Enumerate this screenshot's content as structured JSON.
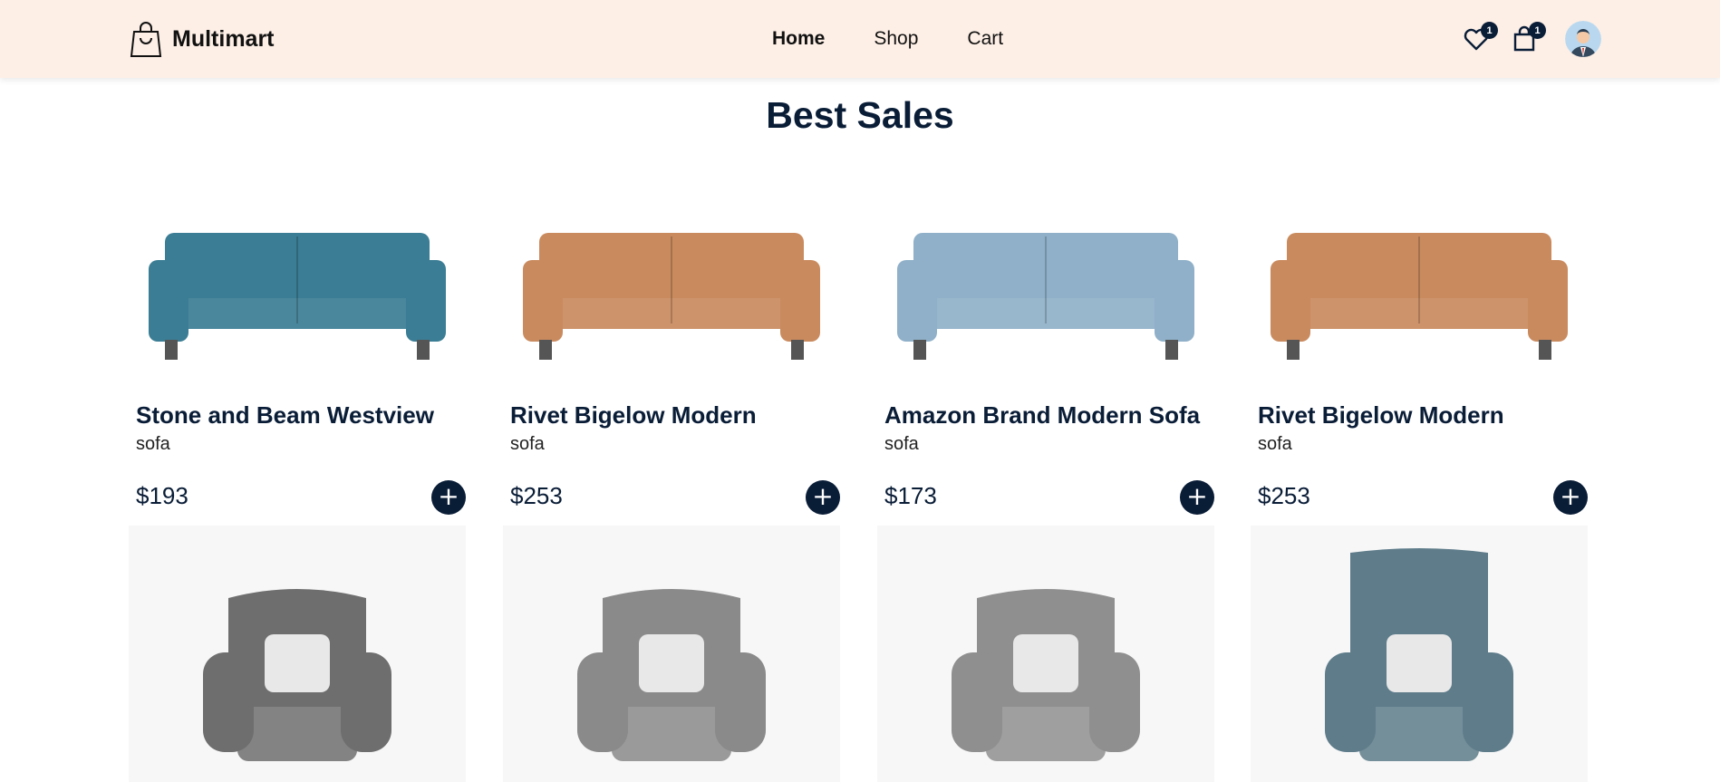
{
  "navbar": {
    "brand": "Multimart",
    "links": [
      {
        "label": "Home",
        "active": true
      },
      {
        "label": "Shop",
        "active": false
      },
      {
        "label": "Cart",
        "active": false
      }
    ],
    "wishlist_count": "1",
    "cart_count": "1",
    "avatar_icon": "user-avatar-icon"
  },
  "section": {
    "title": "Best Sales"
  },
  "products": [
    {
      "name": "Stone and Beam Westview",
      "category": "sofa",
      "price": "$193",
      "color": "#3b7d94"
    },
    {
      "name": "Rivet Bigelow Modern",
      "category": "sofa",
      "price": "$253",
      "color": "#c98a5e"
    },
    {
      "name": "Amazon Brand Modern Sofa",
      "category": "sofa",
      "price": "$173",
      "color": "#8fb0c8"
    },
    {
      "name": "Rivet Bigelow Modern",
      "category": "sofa",
      "price": "$253",
      "color": "#c98a5e"
    }
  ],
  "chairs": [
    {
      "icon": "armchair-image",
      "color": "#6e6e6e"
    },
    {
      "icon": "wingback-chair-image",
      "color": "#8a8a8a"
    },
    {
      "icon": "wingback-chair-fur-image",
      "color": "#8f8f8f"
    },
    {
      "icon": "blue-armchair-image",
      "color": "#5e7c8a"
    }
  ],
  "colors": {
    "navbar_bg": "#fdefe6",
    "primary": "#0a1d37"
  }
}
